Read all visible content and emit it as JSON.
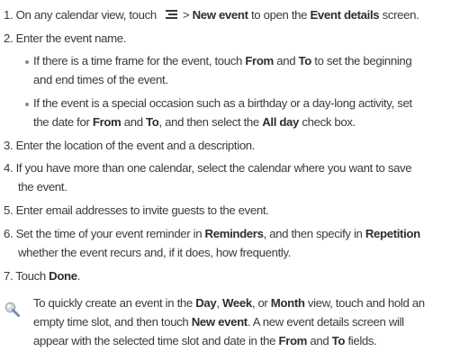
{
  "steps": {
    "s1": {
      "num": "1.",
      "pre": "On any calendar view, touch",
      "gt": ">",
      "new_event": "New event",
      "mid": "to open the",
      "event_details": "Event details",
      "post": "screen."
    },
    "s2": {
      "text": "2. Enter the event name."
    },
    "b1": {
      "l1_pre": "If there is a time frame for the event, touch",
      "from": "From",
      "and": "and",
      "to": "To",
      "l1_post": "to set the beginning",
      "l2": "and end times of the event."
    },
    "b2": {
      "l1": "If the event is a special occasion such as a birthday or a day-long activity, set",
      "l2_pre": "the date for",
      "from": "From",
      "and": "and",
      "to": "To",
      "l2_mid": ", and then select the",
      "all_day": "All day",
      "l2_post": "check box."
    },
    "s3": {
      "text": "3. Enter the location of the event and a description."
    },
    "s4": {
      "l1": "4. If you have more than one calendar, select the calendar where you want to save",
      "l2": "the event."
    },
    "s5": {
      "text": "5. Enter email addresses to invite guests to the event."
    },
    "s6": {
      "l1_pre": "6. Set the time of your event reminder in",
      "reminders": "Reminders",
      "l1_mid": ", and then specify in",
      "repetition": "Repetition",
      "l2": "whether the event recurs and, if it does, how frequently."
    },
    "s7": {
      "pre": "7. Touch",
      "done": "Done",
      "post": "."
    }
  },
  "tip": {
    "icon": "tip-icon",
    "l1_pre": "To quickly create an event in the",
    "day": "Day",
    "comma1": ",",
    "week": "Week",
    "or": ", or",
    "month": "Month",
    "l1_post": "view, touch and hold an",
    "l2_pre": "empty time slot, and then touch",
    "new_event": "New event",
    "l2_post": ". A new event details screen will",
    "l3_pre": "appear with the selected time slot and date in the",
    "from": "From",
    "and": "and",
    "to": "To",
    "l3_post": "fields."
  }
}
